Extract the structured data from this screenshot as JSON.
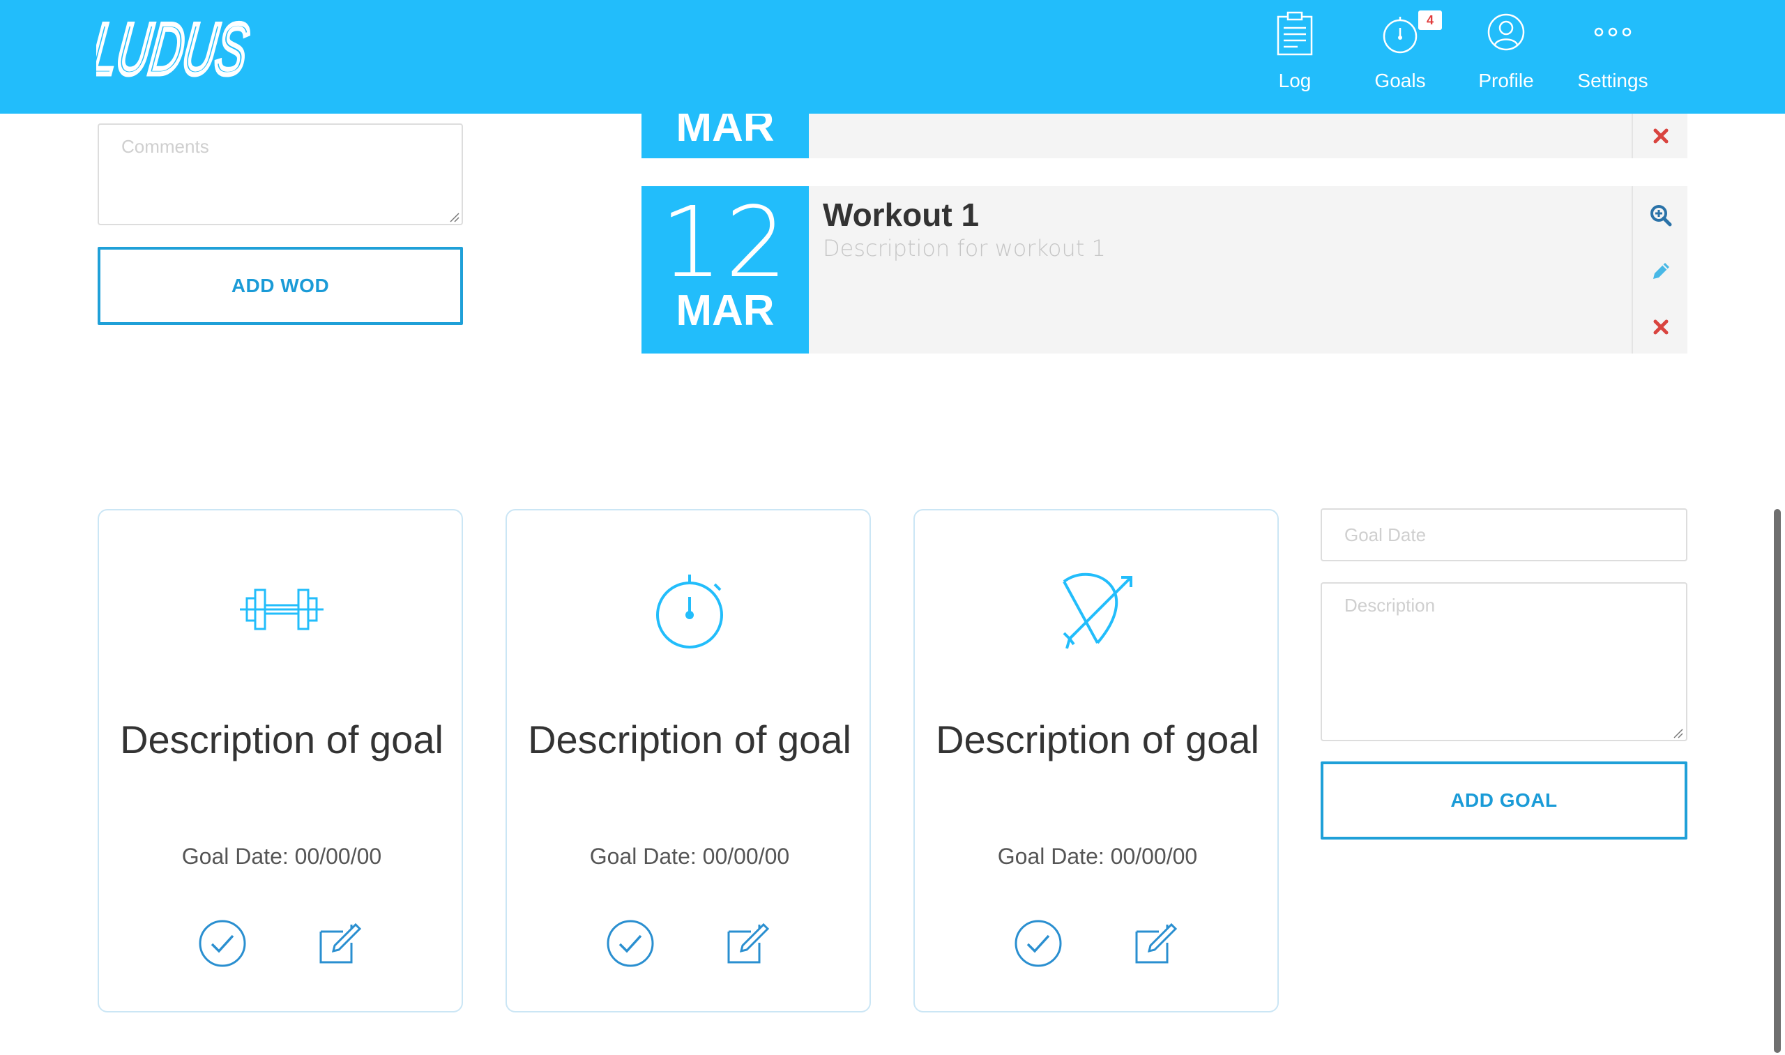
{
  "header": {
    "logo_text": "LUDUS",
    "brand_color": "#22bdfb",
    "nav": [
      {
        "label": "Log",
        "icon": "clipboard-icon"
      },
      {
        "label": "Goals",
        "icon": "stopwatch-icon",
        "badge": "4"
      },
      {
        "label": "Profile",
        "icon": "user-circle-icon"
      },
      {
        "label": "Settings",
        "icon": "more-dots-icon"
      }
    ]
  },
  "wod_form": {
    "comments_placeholder": "Comments",
    "add_button": "ADD WOD"
  },
  "workouts": [
    {
      "day": "",
      "month": "MAR",
      "title": "",
      "description": ""
    },
    {
      "day": "12",
      "month": "MAR",
      "title": "Workout 1",
      "description": "Description for workout 1"
    }
  ],
  "goals": [
    {
      "icon": "dumbbell-icon",
      "description": "Description of goal",
      "date_text": "Goal Date: 00/00/00"
    },
    {
      "icon": "stopwatch-icon",
      "description": "Description of goal",
      "date_text": "Goal Date: 00/00/00"
    },
    {
      "icon": "bow-arrow-icon",
      "description": "Description of goal",
      "date_text": "Goal Date: 00/00/00"
    }
  ],
  "goal_form": {
    "date_placeholder": "Goal Date",
    "description_placeholder": "Description",
    "add_button": "ADD GOAL"
  },
  "colors": {
    "accent": "#22bdfb",
    "button_border": "#1fa0d8",
    "delete": "#d9443f",
    "view": "#2a72a8",
    "edit": "#48b8e6"
  }
}
